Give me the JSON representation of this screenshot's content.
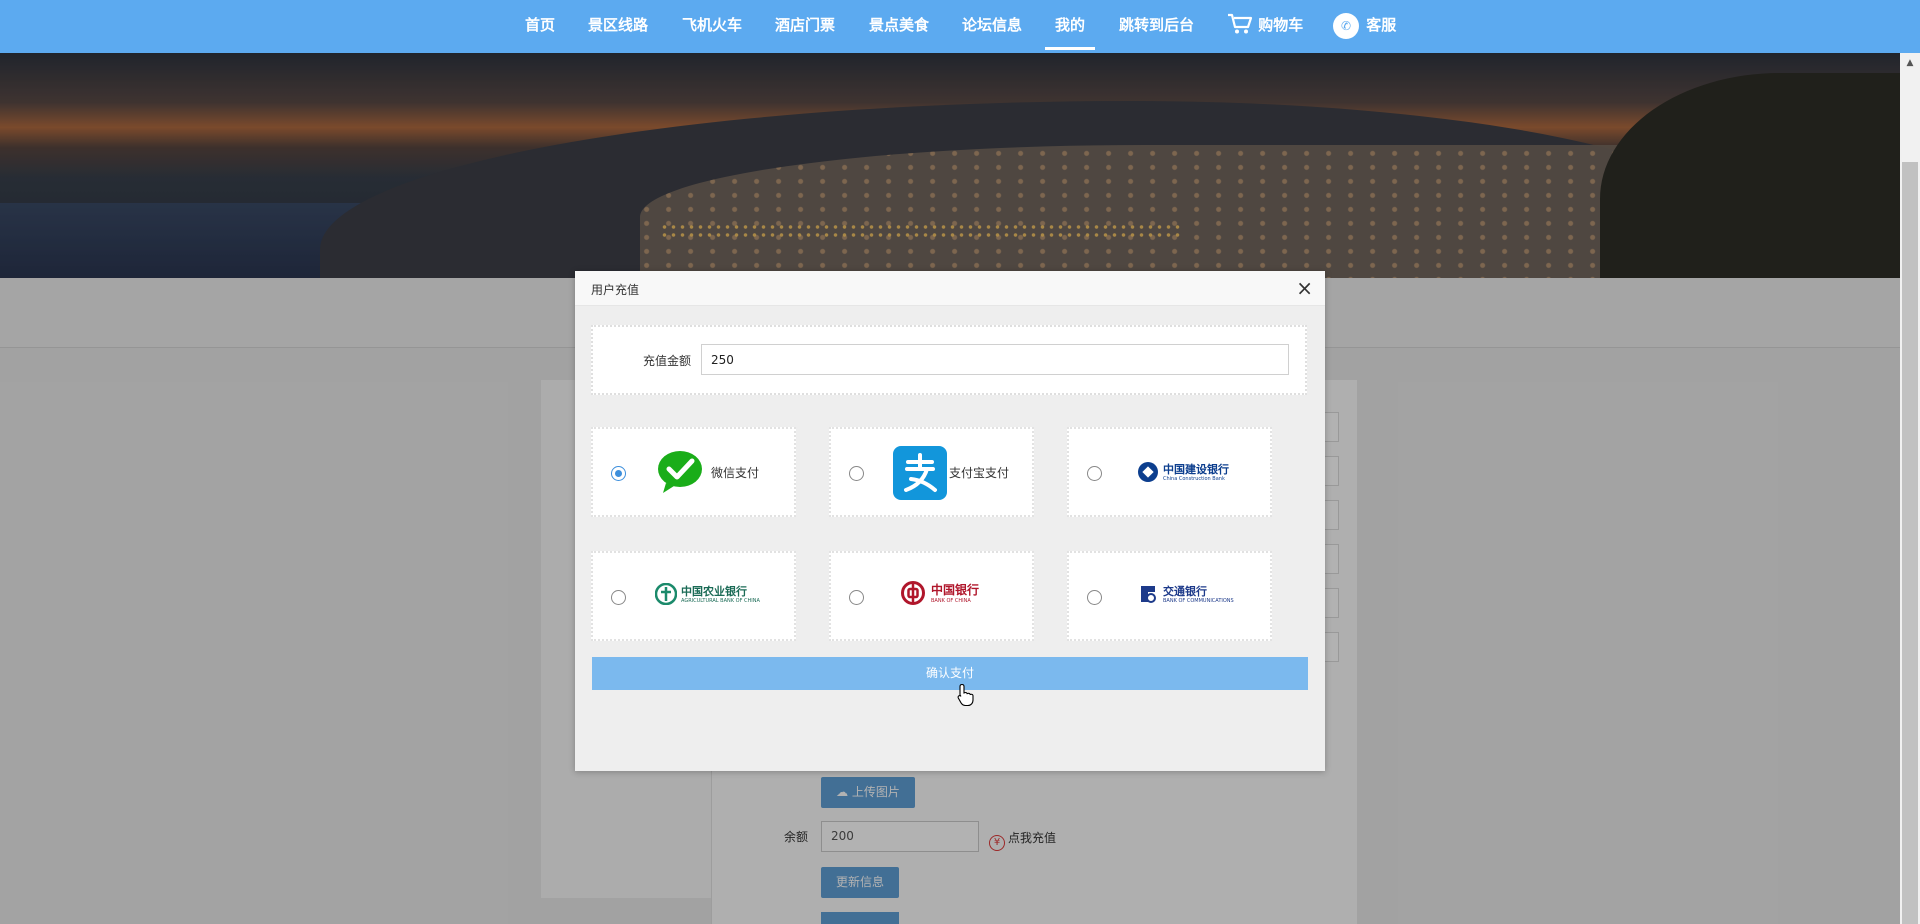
{
  "nav": {
    "items": [
      "首页",
      "景区线路",
      "飞机火车",
      "酒店门票",
      "景点美食",
      "论坛信息",
      "我的",
      "跳转到后台"
    ],
    "active_index": 6,
    "cart_label": "购物车",
    "service_label": "客服"
  },
  "profile": {
    "upload_label": "上传图片",
    "balance_label": "余额",
    "balance_value": "200",
    "recharge_link": "点我充值",
    "update_label": "更新信息"
  },
  "modal": {
    "title": "用户充值",
    "close_glyph": "×",
    "amount_label": "充值金额",
    "amount_value": "250",
    "payment_methods": [
      {
        "label": "微信支付",
        "selected": true,
        "icon": "wechat-pay-icon"
      },
      {
        "label": "支付宝支付",
        "selected": false,
        "icon": "alipay-icon"
      },
      {
        "label": "中国建设银行",
        "selected": false,
        "icon": "ccb-logo"
      },
      {
        "label": "中国农业银行",
        "selected": false,
        "icon": "abc-logo"
      },
      {
        "label": "中国银行",
        "selected": false,
        "icon": "boc-logo"
      },
      {
        "label": "交通银行",
        "selected": false,
        "icon": "bocom-logo"
      }
    ],
    "bank_subtitles": {
      "ccb": "China Construction Bank",
      "abc": "AGRICULTURAL BANK OF CHINA",
      "boc": "BANK OF CHINA",
      "bocom": "BANK OF COMMUNICATIONS"
    },
    "confirm_label": "确认支付"
  },
  "colors": {
    "nav_bg": "#5caaf0",
    "confirm_bg": "#7bb9ee",
    "button_bg": "#5f9fd6",
    "radio_accent": "#3d8fdc",
    "wechat_green": "#1aad19",
    "alipay_blue": "#1296db"
  }
}
